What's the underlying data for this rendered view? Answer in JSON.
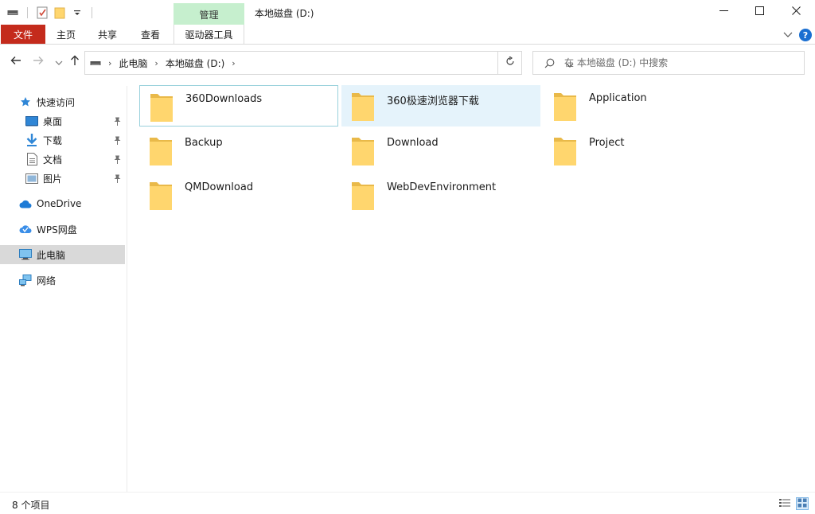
{
  "colors": {
    "file_tab": "#c42b1c",
    "tool_group": "#c6efce",
    "selection": "#d9d9d9",
    "hover": "#e5f3fb",
    "focus_border": "#99d1dc",
    "folder": "#ffd66e"
  },
  "titlebar": {
    "title": "本地磁盘 (D:)",
    "tool_group_label": "管理",
    "qat_icons": [
      "drive-icon",
      "properties-icon",
      "new-folder-icon",
      "customize-qat-icon"
    ],
    "window_controls": [
      "minimize-icon",
      "maximize-icon",
      "close-icon"
    ]
  },
  "ribbon": {
    "tabs": [
      {
        "label": "文件"
      },
      {
        "label": "主页"
      },
      {
        "label": "共享"
      },
      {
        "label": "查看"
      },
      {
        "label": "驱动器工具"
      }
    ],
    "expand_icon": "chevron-down-icon",
    "help_label": "?"
  },
  "navigation": {
    "back_icon": "back-arrow-icon",
    "forward_icon": "forward-arrow-icon",
    "recent_icon": "recent-locations-icon",
    "up_icon": "up-arrow-icon",
    "breadcrumb": [
      {
        "label": "此电脑"
      },
      {
        "label": "本地磁盘 (D:)"
      }
    ],
    "refresh_icon": "refresh-icon",
    "search_placeholder": "在 本地磁盘 (D:) 中搜索"
  },
  "sidebar": {
    "items": [
      {
        "label": "快速访问",
        "icon": "star-icon"
      },
      {
        "label": "桌面",
        "icon": "desktop-icon",
        "pinned": true
      },
      {
        "label": "下载",
        "icon": "download-icon",
        "pinned": true
      },
      {
        "label": "文档",
        "icon": "document-icon",
        "pinned": true
      },
      {
        "label": "图片",
        "icon": "picture-icon",
        "pinned": true
      },
      {
        "label": "OneDrive",
        "icon": "cloud-icon"
      },
      {
        "label": "WPS网盘",
        "icon": "wps-cloud-icon"
      },
      {
        "label": "此电脑",
        "icon": "computer-icon",
        "selected": true
      },
      {
        "label": "网络",
        "icon": "network-icon"
      }
    ]
  },
  "folders": [
    {
      "name": "360Downloads",
      "state": "focused"
    },
    {
      "name": "360极速浏览器下载",
      "state": "hovered"
    },
    {
      "name": "Application"
    },
    {
      "name": "Backup"
    },
    {
      "name": "Download"
    },
    {
      "name": "Project"
    },
    {
      "name": "QMDownload"
    },
    {
      "name": "WebDevEnvironment"
    }
  ],
  "statusbar": {
    "item_count": "8 个项目",
    "view_icons": [
      "details-view-icon",
      "large-icons-view-icon"
    ]
  }
}
